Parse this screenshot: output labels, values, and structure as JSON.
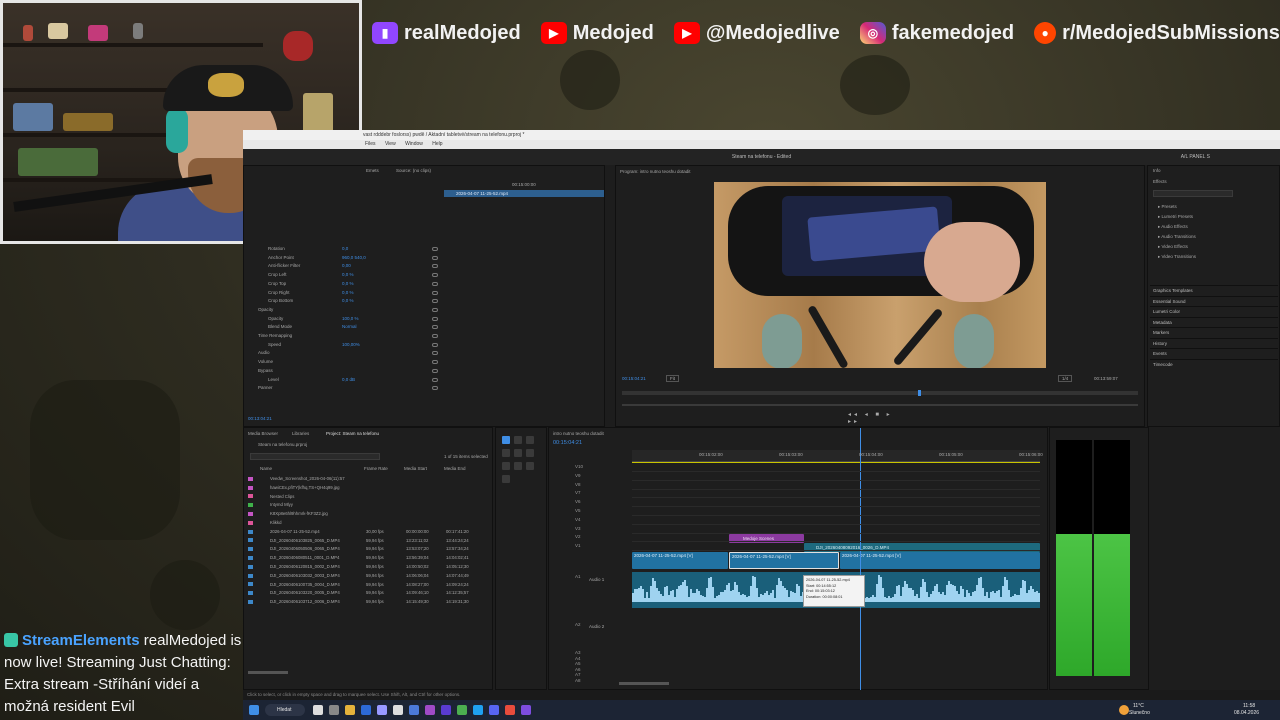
{
  "social": [
    {
      "platform": "twitch",
      "icon": "twitch-icon",
      "color": "#9146ff",
      "handle": "realMedojed"
    },
    {
      "platform": "youtube",
      "icon": "youtube-icon",
      "color": "#ff0000",
      "handle": "Medojed"
    },
    {
      "platform": "youtube",
      "icon": "youtube-icon",
      "color": "#ff0000",
      "handle": "@Medojedlive"
    },
    {
      "platform": "instagram",
      "icon": "instagram-icon",
      "color": "#d62976",
      "handle": "fakemedojed"
    },
    {
      "platform": "reddit",
      "icon": "reddit-icon",
      "color": "#ff4500",
      "handle": "r/MedojedSubMissions"
    }
  ],
  "premiere": {
    "window_title": "vast rdddebr foslorss) pwdě / Aktadní tabletvé/stream na telefonu.prproj *",
    "menu": [
      "Files",
      "View",
      "Window",
      "Help"
    ],
    "sequence_title": "Steam na telefonu - Edited",
    "workspace": "A/L PANEL S",
    "effect_controls": {
      "tabs": [
        "Emets",
        "Source: (no clips)"
      ],
      "clip_name": "2026-04-07 11-25-52.mp4",
      "time_head": "00:15:00:00",
      "rows": [
        {
          "name": "Rotation",
          "value": "0,0"
        },
        {
          "name": "Anchor Point",
          "value": "960,0   540,0"
        },
        {
          "name": "Anti-flicker Filter",
          "value": "0,00"
        },
        {
          "name": "Crop Left",
          "value": "0,0 %"
        },
        {
          "name": "Crop Top",
          "value": "0,0 %"
        },
        {
          "name": "Crop Right",
          "value": "0,0 %"
        },
        {
          "name": "Crop Bottom",
          "value": "0,0 %"
        },
        {
          "name": "Opacity",
          "value": ""
        },
        {
          "name": "Opacity",
          "value": "100,0 %"
        },
        {
          "name": "Blend Mode",
          "value": "Normal"
        },
        {
          "name": "Time Remapping",
          "value": ""
        },
        {
          "name": "Speed",
          "value": "100,00%"
        },
        {
          "name": "Audio",
          "value": ""
        },
        {
          "name": "Volume",
          "value": ""
        },
        {
          "name": "Bypass",
          "value": ""
        },
        {
          "name": "Level",
          "value": "0,0 dB"
        },
        {
          "name": "Panner",
          "value": ""
        }
      ],
      "footer_time": "00:13:04:21"
    },
    "program": {
      "tab": "Program: intro nutno teoshu dotadit",
      "timecode": "00:15:04:21",
      "fit": "Fit",
      "quality": "1/4",
      "duration": "00:13:59:07"
    },
    "side_panel": {
      "tabs": [
        "Info",
        "Effects"
      ],
      "effects": [
        "Presets",
        "Lumetri Presets",
        "Audio Effects",
        "Audio Transitions",
        "Video Effects",
        "Video Transitions"
      ],
      "sections": [
        "Graphics Templates",
        "Essential Sound",
        "Lumetri Color",
        "Metadata",
        "Markers",
        "History",
        "Events",
        "Timecode"
      ]
    },
    "project": {
      "tabs": [
        "Media Browser",
        "Libraries",
        "Project: Steam na telefonu"
      ],
      "project_file": "Steam na telefonu.prproj",
      "selection": "1 of 15 items selected",
      "columns": [
        "Name",
        "Frame Rate",
        "Media Start",
        "Media End"
      ],
      "items": [
        {
          "name": "Veedw_Screenshot_2026-04-06(11):57",
          "fps": "",
          "start": "",
          "end": "",
          "color": "#c455c4"
        },
        {
          "name": "hawiCEx,pfiTY|kfhq,TS+QH4q99.jpg",
          "fps": "",
          "start": "",
          "end": "",
          "color": "#c455c4"
        },
        {
          "name": "Nested Clips",
          "fps": "",
          "start": "",
          "end": "",
          "color": "#dd5599"
        },
        {
          "name": "Intymd Mlyy",
          "fps": "",
          "start": "",
          "end": "",
          "color": "#3fb14a"
        },
        {
          "name": "K8Xp8e6hl9hhmrk-fKF3Z2.jpg",
          "fps": "",
          "start": "",
          "end": "",
          "color": "#c455c4"
        },
        {
          "name": "Klikkd",
          "fps": "",
          "start": "",
          "end": "",
          "color": "#dd5599"
        },
        {
          "name": "2026-04-07 11-25-52.mp4",
          "fps": "30,00 fps",
          "start": "00:00:00:00",
          "end": "00:17:41:20",
          "color": "#3d88c9"
        },
        {
          "name": "DJI_20260406103825_0065_D.MP4",
          "fps": "59,94 fps",
          "start": "13:23:11;02",
          "end": "13:44:24;24",
          "color": "#3d88c9"
        },
        {
          "name": "DJI_20260406050506_0065_D.MP4",
          "fps": "59,94 fps",
          "start": "13:53:07;20",
          "end": "13:57:34;24",
          "color": "#3d88c9"
        },
        {
          "name": "DJI_20260406080511_0001_D.MP4",
          "fps": "59,94 fps",
          "start": "13:56:39;04",
          "end": "14:04:02;41",
          "color": "#3d88c9"
        },
        {
          "name": "DJI_20260406120815_0002_D.MP4",
          "fps": "59,94 fps",
          "start": "14:00:50;02",
          "end": "14:05:12;30",
          "color": "#3d88c9"
        },
        {
          "name": "DJI_20260406103032_0003_D.MP4",
          "fps": "59,94 fps",
          "start": "14:06:06;04",
          "end": "14:07:44;49",
          "color": "#3d88c9"
        },
        {
          "name": "DJI_20260406100735_0004_D.MP4",
          "fps": "59,94 fps",
          "start": "14:08:27;00",
          "end": "14:09:24;24",
          "color": "#3d88c9"
        },
        {
          "name": "DJI_20260406103220_0005_D.MP4",
          "fps": "59,94 fps",
          "start": "14:09:46;10",
          "end": "14:12:35;57",
          "color": "#3d88c9"
        },
        {
          "name": "DJI_20260406103712_0006_D.MP4",
          "fps": "59,94 fps",
          "start": "14:15:49;30",
          "end": "14:19:31;30",
          "color": "#3d88c9"
        }
      ]
    },
    "timeline": {
      "tab": "intro nutno teoshu dotadit",
      "timecode": "00:15:04:21",
      "ruler": [
        "00:15:02:00",
        "00:15:03:00",
        "00:15:04:00",
        "00:15:05:00",
        "00:15:06:00"
      ],
      "video_tracks": [
        "V10",
        "V9",
        "V8",
        "V7",
        "V6",
        "V5",
        "V4",
        "V3",
        "V2",
        "V1"
      ],
      "audio_tracks": [
        "A1",
        "A2",
        "A3",
        "A4",
        "A5",
        "A6",
        "A7",
        "A8"
      ],
      "audio1_label": "Audio 1",
      "audio2_label": "Audio 2",
      "clips": {
        "graphic": "Medoje Scenes",
        "nested": "DJI_20260408092016_0026_D.MP4",
        "v1a": "2026-04-07 11-25-52.mp4 [V]",
        "v1b": "2026-04-07 11-25-52.mp4 [V]",
        "v1c": "2026-04-07 11-25-52.mp4 [V]"
      },
      "tooltip": [
        "2026-04-07 11-25-52.mp4",
        "Start: 00:14:55:12",
        "End: 00:15:03:12",
        "Duration: 00:00:08:01"
      ]
    },
    "status": "Click to select, or click in empty space and drag to marquee select. Use Shift, Alt, and Ctrl for other options."
  },
  "taskbar": {
    "search": "Hledat",
    "weather": "11°C",
    "weather_desc": "Slunečno",
    "time": "11:58",
    "date": "08.04.2026"
  },
  "chat": {
    "author": "StreamElements",
    "message": "realMedojed is now live! Streaming Just Chatting: Extra stream -Stříhání videí a možná resident Evil"
  }
}
